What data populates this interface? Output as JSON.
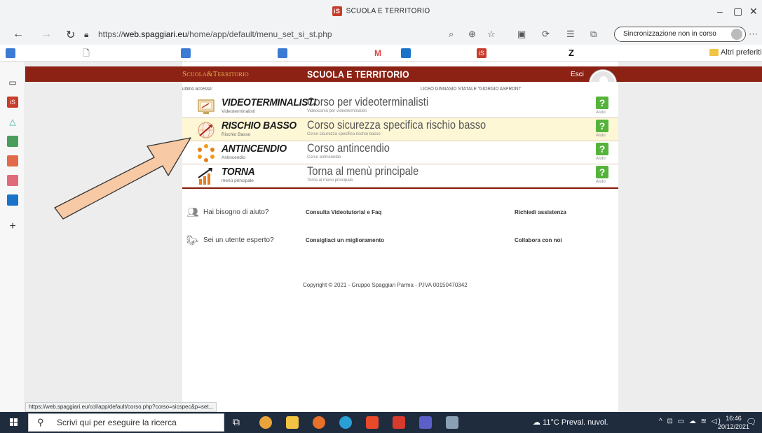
{
  "browser": {
    "tab_title": "SCUOLA E TERRITORIO",
    "tab_favicon": "iS",
    "url_prefix": "https://",
    "url_domain": "web.spaggiari.eu",
    "url_path": "/home/app/default/menu_set_si_st.php",
    "sync_label": "Sincronizzazione non in corso",
    "altri_preferiti": "Altri preferiti",
    "status_url": "https://web.spaggiari.eu/col/app/default/corso.php?corso=sicspec&p=set..."
  },
  "header": {
    "brand": "Scuola&Territorio",
    "title": "SCUOLA E TERRITORIO",
    "logout": "Esci"
  },
  "info": {
    "last_access": "ultimo accesso:",
    "school": "LICEO GINNASIO STATALE \"GIORGIO ASPRONI\""
  },
  "menu": [
    {
      "code": "VIDEOTERMINALISTI",
      "code_sub": "Videoterminalisti",
      "desc": "Corso per videoterminalisti",
      "desc_sub": "Videocorso per videoterminalisti",
      "help": "Aiuto",
      "icon": "monitor-icon"
    },
    {
      "code": "RISCHIO BASSO",
      "code_sub": "Rischio Basso",
      "desc": "Corso sicurezza specifica rischio basso",
      "desc_sub": "Corso sicurezza specifica rischio basso",
      "help": "Aiuto",
      "icon": "globe-icon"
    },
    {
      "code": "ANTINCENDIO",
      "code_sub": "Antincendio",
      "desc": "Corso antincendio",
      "desc_sub": "Corso antincendio",
      "help": "Aiuto",
      "icon": "fire-icon"
    },
    {
      "code": "TORNA",
      "code_sub": "menù principale",
      "desc": "Torna al menù principale",
      "desc_sub": "Torna al menù principale",
      "help": "Aiuto",
      "icon": "chart-up-icon"
    }
  ],
  "support": [
    {
      "text": "Hai bisogno di aiuto?",
      "link1": "Consulta Videotutorial e Faq",
      "link2": "Richiedi assistenza"
    },
    {
      "text": "Sei un utente esperto?",
      "link1": "Consigliaci un miglioramento",
      "link2": "Collabora con noi"
    }
  ],
  "copyright": "Copyright © 2021 - Gruppo Spaggiari Parma - P.IVA 00150470342",
  "taskbar": {
    "search_placeholder": "Scrivi qui per eseguire la ricerca",
    "weather": "11°C Preval. nuvol.",
    "time": "16:46",
    "date": "20/12/2021"
  },
  "colors": {
    "header_red": "#8b2214",
    "help_green": "#55b33b",
    "highlight_row": "#fdf7d6",
    "arrow_fill": "#f7c9a4"
  }
}
